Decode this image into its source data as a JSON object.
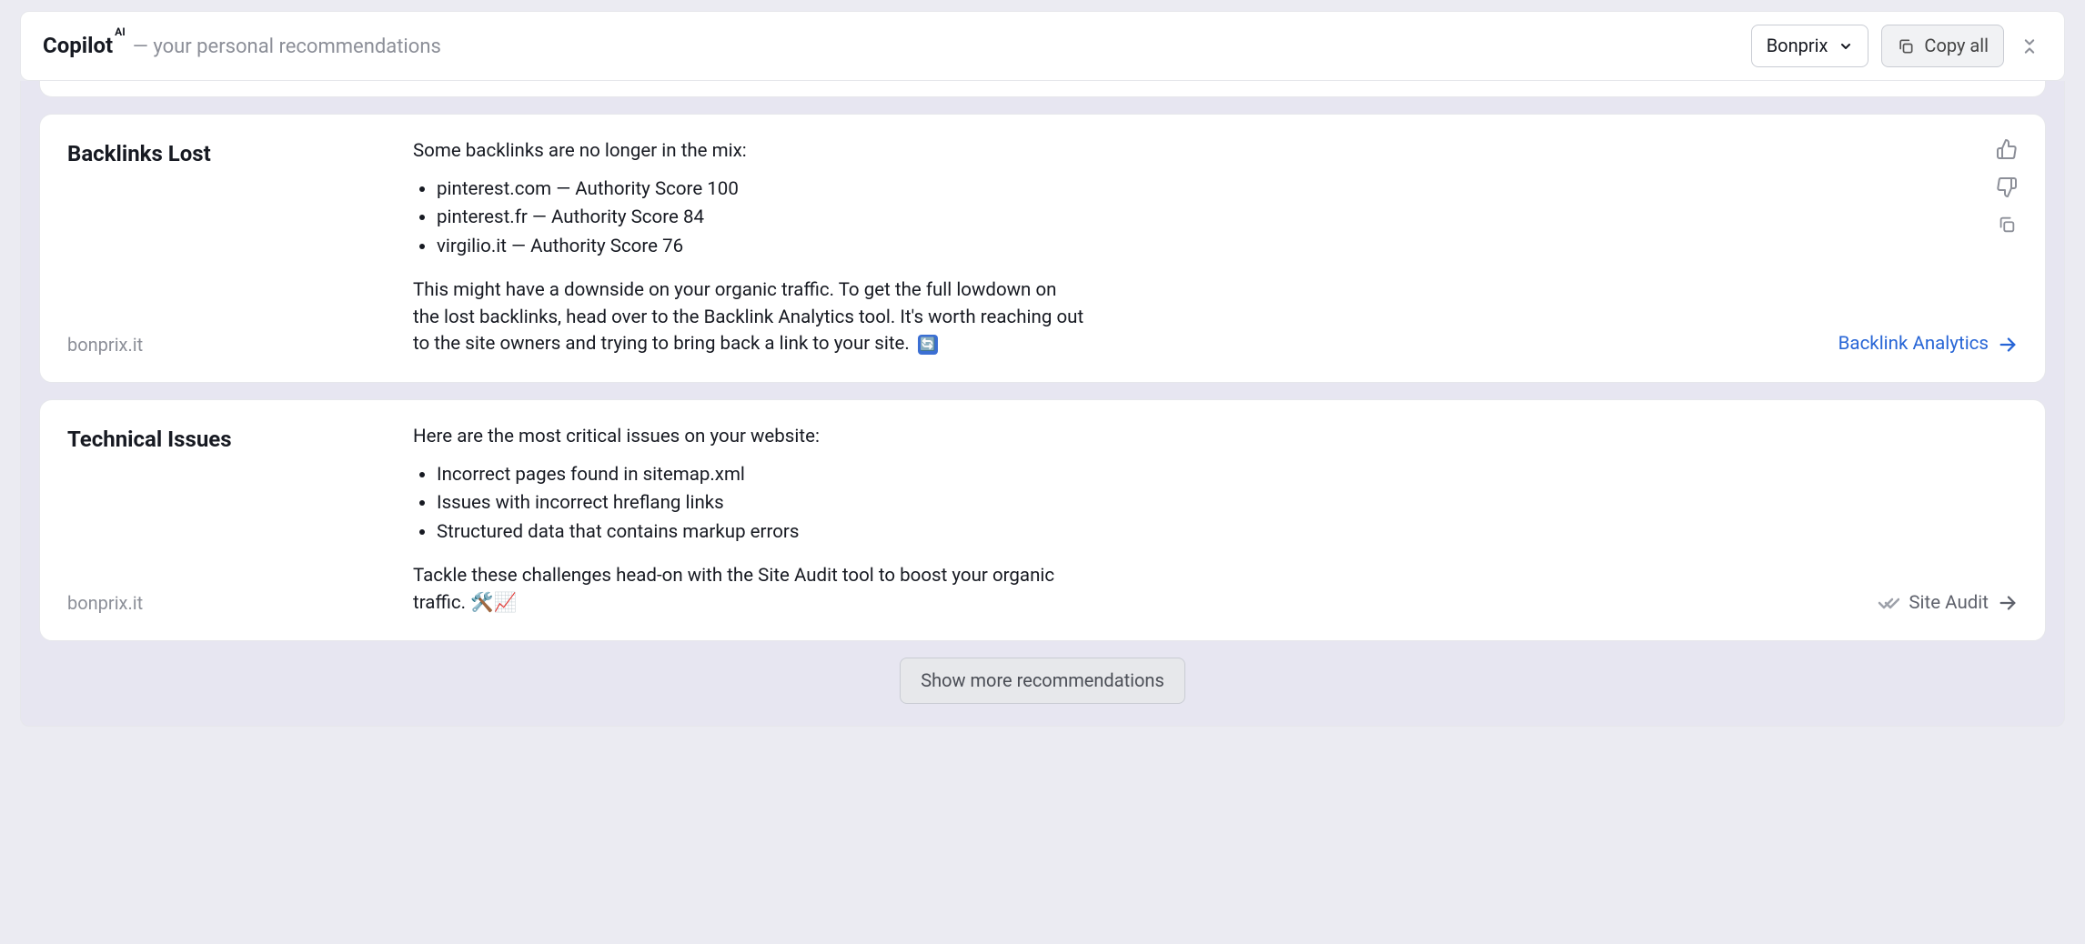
{
  "header": {
    "title": "Copilot",
    "badge": "AI",
    "subtitle_dash": " — ",
    "subtitle": "your personal recommendations",
    "dropdown_value": "Bonprix",
    "copy_all_label": "Copy all"
  },
  "cards": {
    "backlinks": {
      "title": "Backlinks Lost",
      "domain": "bonprix.it",
      "intro": "Some backlinks are no longer in the mix:",
      "items": {
        "0": "pinterest.com — Authority Score 100",
        "1": "pinterest.fr — Authority Score 84",
        "2": "virgilio.it — Authority Score 76"
      },
      "outro": "This might have a downside on your organic traffic. To get the full lowdown on the lost backlinks, head over to the Backlink Analytics tool. It's worth reaching out to the site owners and trying to bring back a link to your site. ",
      "outro_emoji": "🔄",
      "link_label": "Backlink Analytics"
    },
    "technical": {
      "title": "Technical Issues",
      "domain": "bonprix.it",
      "intro": "Here are the most critical issues on your website:",
      "items": {
        "0": "Incorrect pages found in sitemap.xml",
        "1": "Issues with incorrect hreflang links",
        "2": "Structured data that contains markup errors"
      },
      "outro": "Tackle these challenges head-on with the Site Audit tool to boost your organic traffic. ",
      "outro_emoji": "🛠️📈",
      "link_label": "Site Audit"
    }
  },
  "footer": {
    "show_more_label": "Show more recommendations"
  }
}
